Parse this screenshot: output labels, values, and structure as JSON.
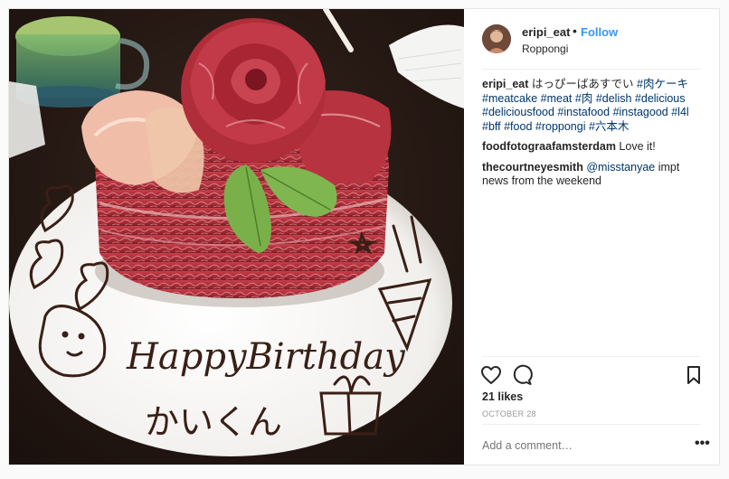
{
  "post": {
    "username": "eripi_eat",
    "separator": "•",
    "follow_label": "Follow",
    "location": "Roppongi"
  },
  "comments": [
    {
      "author": "eripi_eat",
      "text": "はっぴーばあすでい",
      "hashtags": [
        "#肉ケーキ",
        "#meatcake",
        "#meat",
        "#肉",
        "#delish",
        "#delicious",
        "#deliciousfood",
        "#instafood",
        "#instagood",
        "#l4l",
        "#bff",
        "#food",
        "#roppongi",
        "#六本木"
      ]
    },
    {
      "author": "foodfotograafamsterdam",
      "text": "Love it!"
    },
    {
      "author": "thecourtneyesmith",
      "mention": "@misstanyae",
      "text": "impt news from the weekend"
    }
  ],
  "engagement": {
    "likes": "21 likes",
    "date": "OCTOBER 28"
  },
  "add_comment": {
    "placeholder": "Add a comment…",
    "more_label": "•••"
  },
  "photo": {
    "plate_text_1": "HappyBirthday",
    "plate_text_2": "かいくん"
  },
  "icons": {
    "like": "heart-icon",
    "comment": "comment-bubble-icon",
    "save": "bookmark-icon",
    "more": "more-options-icon"
  },
  "colors": {
    "follow": "#3897f0",
    "hashtag": "#003569",
    "muted": "#999999",
    "text": "#262626"
  }
}
